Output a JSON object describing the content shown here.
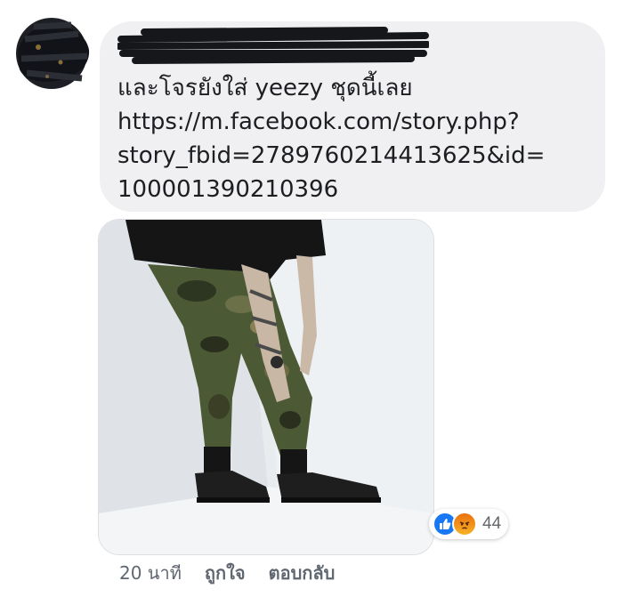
{
  "comment": {
    "lines": [
      "และโจรยังใส่ yeezy ชุดนี้เลย",
      "https://m.facebook.com/story.php?",
      "story_fbid=2789760214413625&id=",
      "100001390210396"
    ],
    "photo": {
      "icon": "photo-icon"
    }
  },
  "reactions": {
    "icons": [
      "like-icon",
      "angry-icon"
    ],
    "count": "44",
    "colors": {
      "like": "#1877f2",
      "angry": "#f0851a"
    }
  },
  "meta": {
    "time": "20 นาที",
    "like_label": "ถูกใจ",
    "reply_label": "ตอบกลับ"
  },
  "colors": {
    "bubble": "#f0f0f2",
    "text": "#1c1e21",
    "meta_text": "#606770"
  }
}
